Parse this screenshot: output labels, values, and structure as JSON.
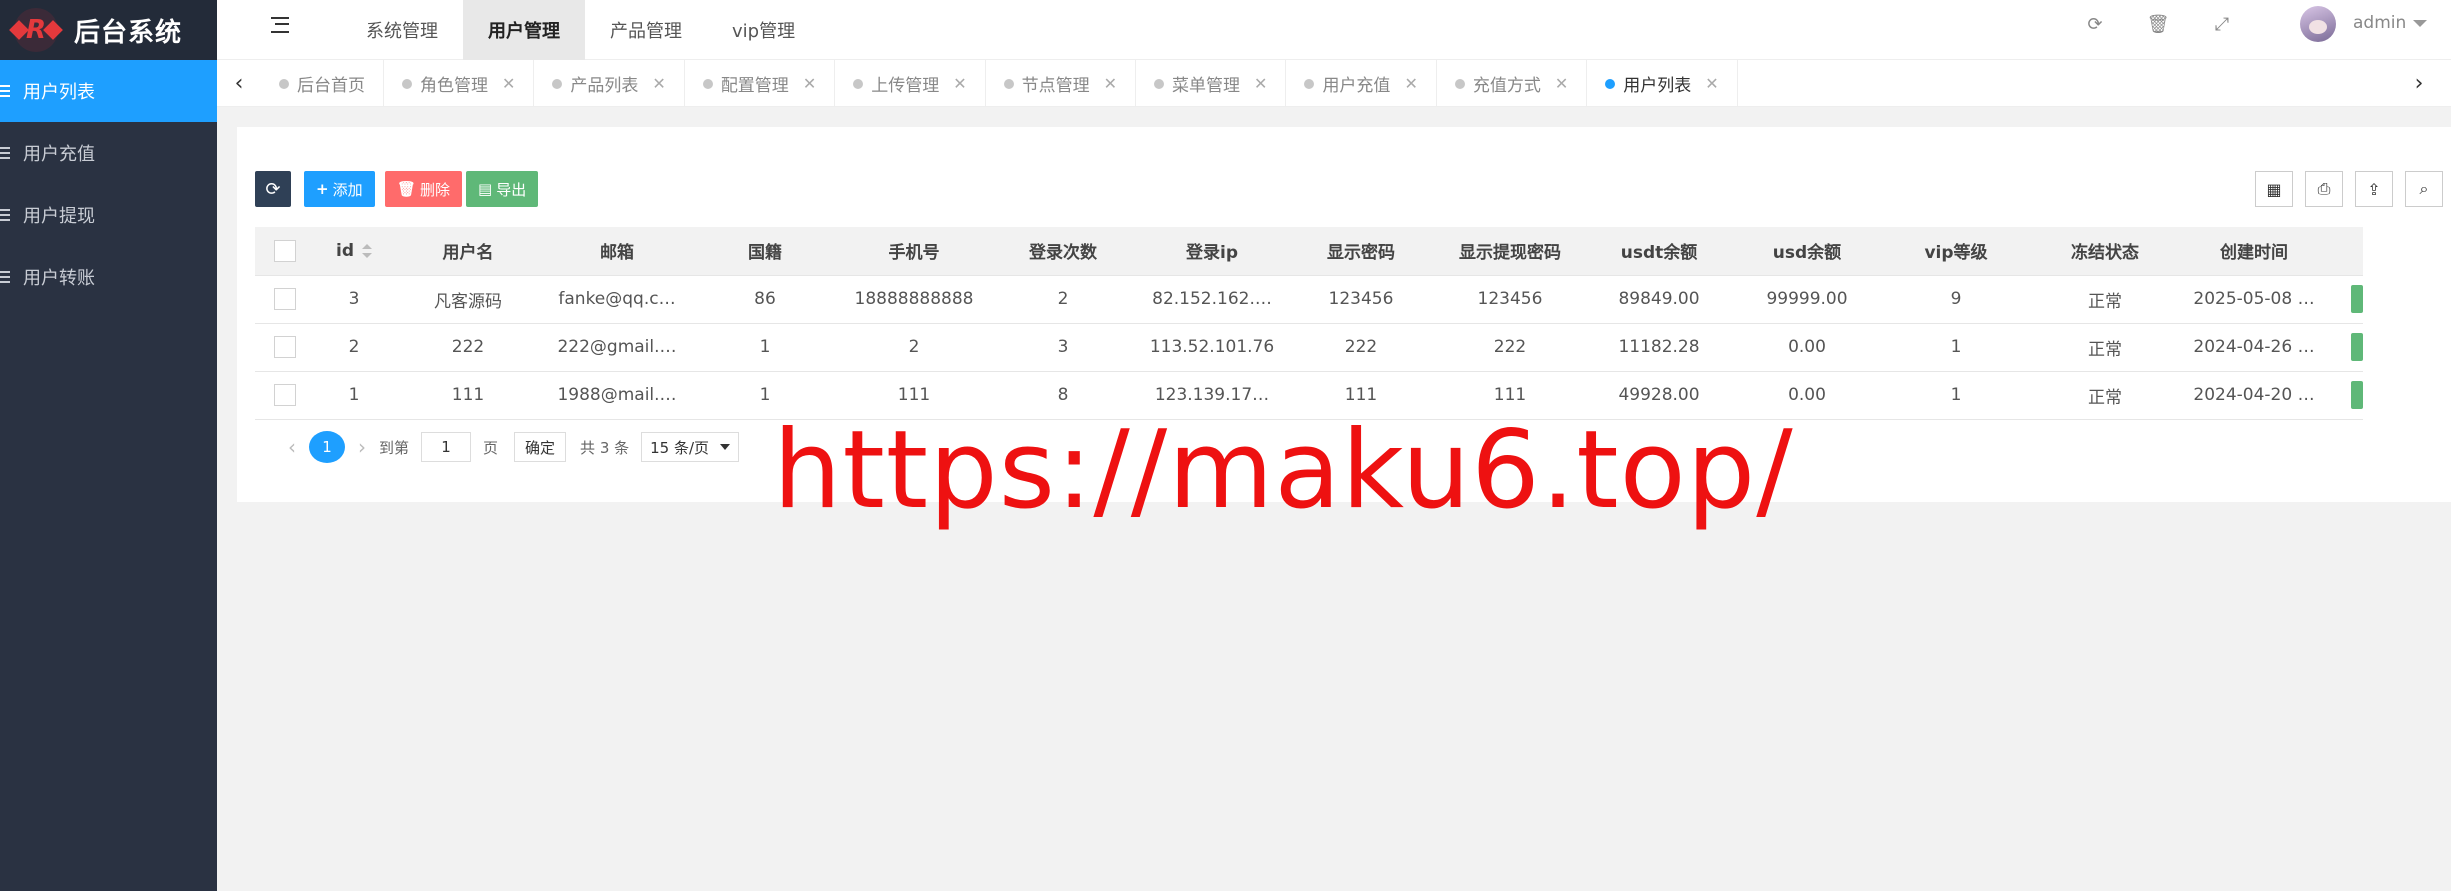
{
  "app": {
    "logo_text": "后台系统",
    "logo_letter": "R"
  },
  "sidebar": {
    "items": [
      {
        "label": "用户列表",
        "active": true
      },
      {
        "label": "用户充值",
        "active": false
      },
      {
        "label": "用户提现",
        "active": false
      },
      {
        "label": "用户转账",
        "active": false
      }
    ]
  },
  "header": {
    "menu": [
      {
        "label": "系统管理",
        "active": false
      },
      {
        "label": "用户管理",
        "active": true
      },
      {
        "label": "产品管理",
        "active": false
      },
      {
        "label": "vip管理",
        "active": false
      }
    ],
    "username": "admin"
  },
  "tabs": [
    {
      "label": "后台首页",
      "closable": false,
      "active": false
    },
    {
      "label": "角色管理",
      "closable": true,
      "active": false
    },
    {
      "label": "产品列表",
      "closable": true,
      "active": false
    },
    {
      "label": "配置管理",
      "closable": true,
      "active": false
    },
    {
      "label": "上传管理",
      "closable": true,
      "active": false
    },
    {
      "label": "节点管理",
      "closable": true,
      "active": false
    },
    {
      "label": "菜单管理",
      "closable": true,
      "active": false
    },
    {
      "label": "用户充值",
      "closable": true,
      "active": false
    },
    {
      "label": "充值方式",
      "closable": true,
      "active": false
    },
    {
      "label": "用户列表",
      "closable": true,
      "active": true
    }
  ],
  "toolbar": {
    "add_label": "添加",
    "delete_label": "删除",
    "export_label": "导出"
  },
  "colors": {
    "sidebar_bg": "#2a3242",
    "primary": "#1e9fff",
    "danger": "#ff5722",
    "success": "#5fb878",
    "dark": "#2f4056",
    "watermark": "#ee1111"
  },
  "table": {
    "columns": [
      "id",
      "用户名",
      "邮箱",
      "国籍",
      "手机号",
      "登录次数",
      "登录ip",
      "显示密码",
      "显示提现密码",
      "usdt余额",
      "usd余额",
      "vip等级",
      "冻结状态",
      "创建时间"
    ],
    "rows": [
      [
        "3",
        "凡客源码",
        "fanke@qq.c…",
        "86",
        "18888888888",
        "2",
        "82.152.162.…",
        "123456",
        "123456",
        "89849.00",
        "99999.00",
        "9",
        "正常",
        "2025-05-08 …"
      ],
      [
        "2",
        "222",
        "222@gmail.…",
        "1",
        "2",
        "3",
        "113.52.101.76",
        "222",
        "222",
        "11182.28",
        "0.00",
        "1",
        "正常",
        "2024-04-26 …"
      ],
      [
        "1",
        "111",
        "1988@mail.…",
        "1",
        "111",
        "8",
        "123.139.17…",
        "111",
        "111",
        "49928.00",
        "0.00",
        "1",
        "正常",
        "2024-04-20 …"
      ]
    ]
  },
  "pager": {
    "current": "1",
    "goto_label": "到第",
    "goto_value": "1",
    "page_unit": "页",
    "confirm_label": "确定",
    "total_label": "共 3 条",
    "page_size": "15 条/页"
  },
  "watermark": "https://maku6.top/"
}
